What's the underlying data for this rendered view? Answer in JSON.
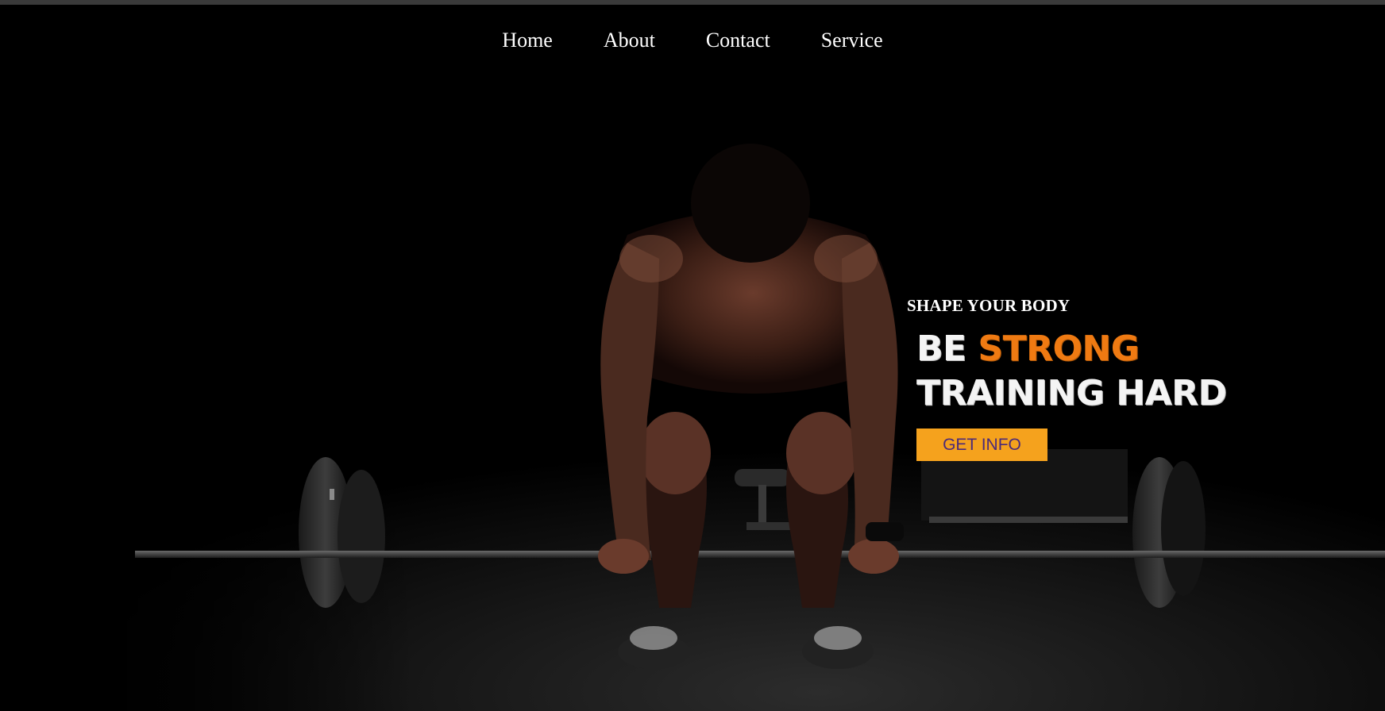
{
  "nav": {
    "items": [
      {
        "label": "Home"
      },
      {
        "label": "About"
      },
      {
        "label": "Contact"
      },
      {
        "label": "Service"
      }
    ]
  },
  "hero": {
    "subtitle": "SHAPE YOUR BODY",
    "headline_line1_white": "BE ",
    "headline_line1_accent": "STRONG",
    "headline_line2": "TRAINING HARD",
    "cta_label": "GET INFO"
  },
  "colors": {
    "background": "#000000",
    "accent": "#ef7a12",
    "cta_background": "#f5a21d",
    "cta_text": "#4a2a7a",
    "text": "#ffffff"
  }
}
